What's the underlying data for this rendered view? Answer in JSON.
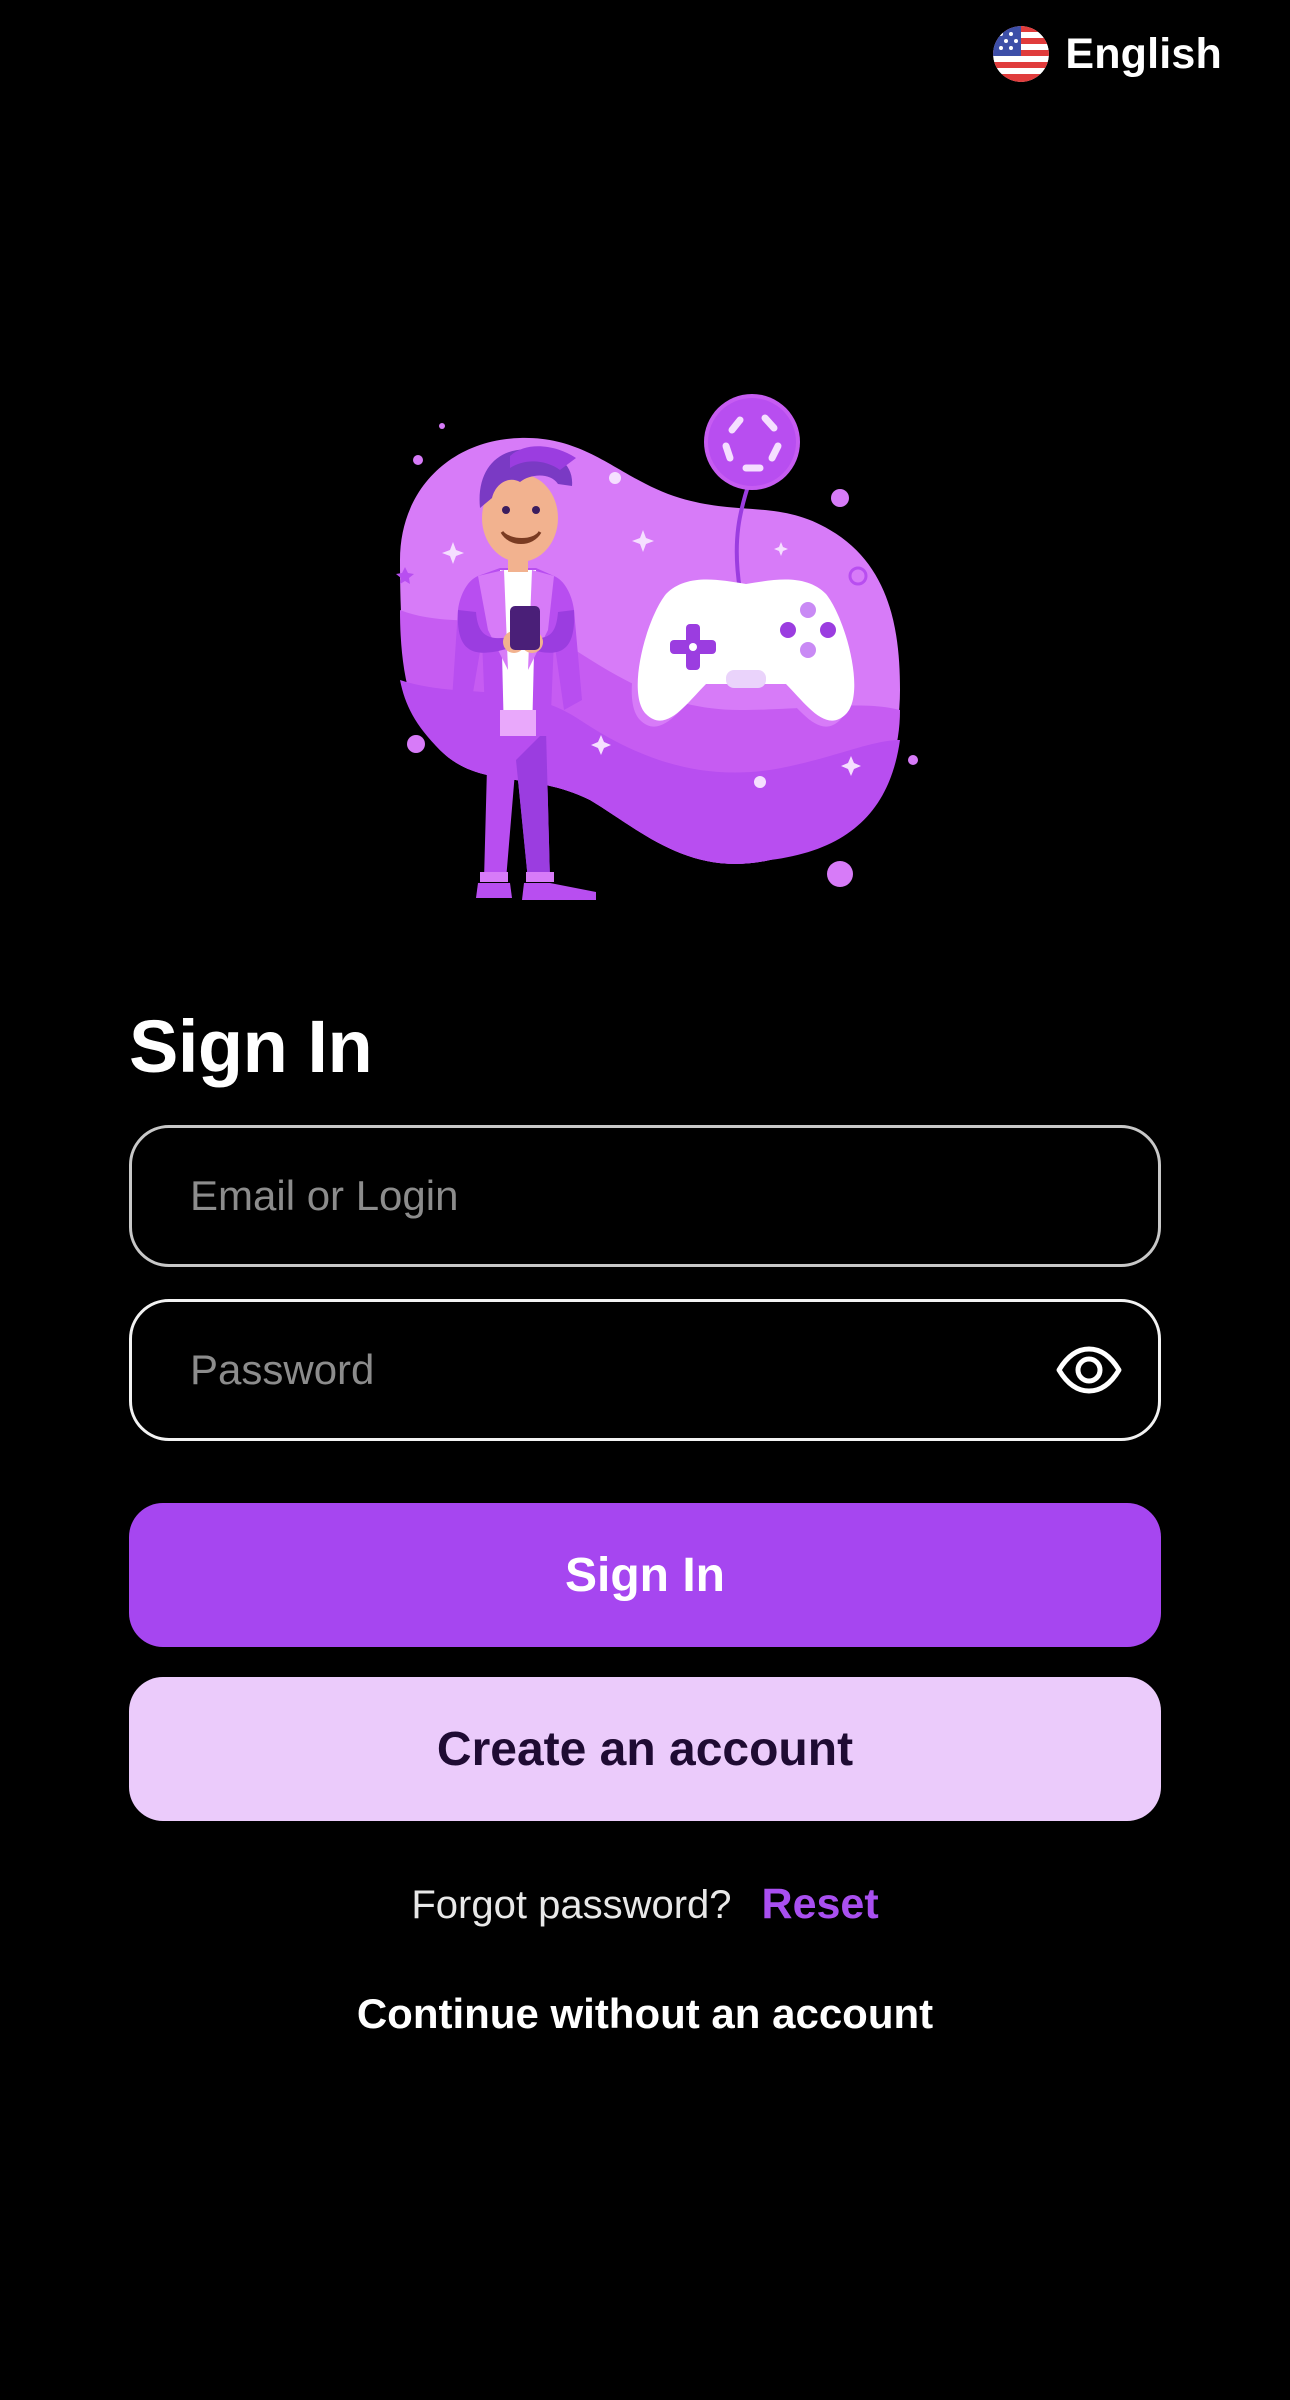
{
  "language": {
    "label": "English",
    "flag_icon": "us-flag-icon"
  },
  "hero": {
    "illustration": "gamer-with-controller-illustration",
    "colors": {
      "blob": "#d77bf8",
      "accent": "#a646f0",
      "dark": "#5b2a8c"
    }
  },
  "signin": {
    "title": "Sign In",
    "email_placeholder": "Email or Login",
    "password_placeholder": "Password",
    "password_toggle_icon": "eye-icon",
    "submit_label": "Sign In",
    "create_account_label": "Create an account",
    "forgot_text": "Forgot password?",
    "reset_label": "Reset",
    "continue_label": "Continue without an account"
  },
  "colors": {
    "background": "#000000",
    "primary": "#a646f0",
    "secondary": "#ebcbfb",
    "secondary_text": "#1f0b33",
    "link": "#a94ff0"
  }
}
